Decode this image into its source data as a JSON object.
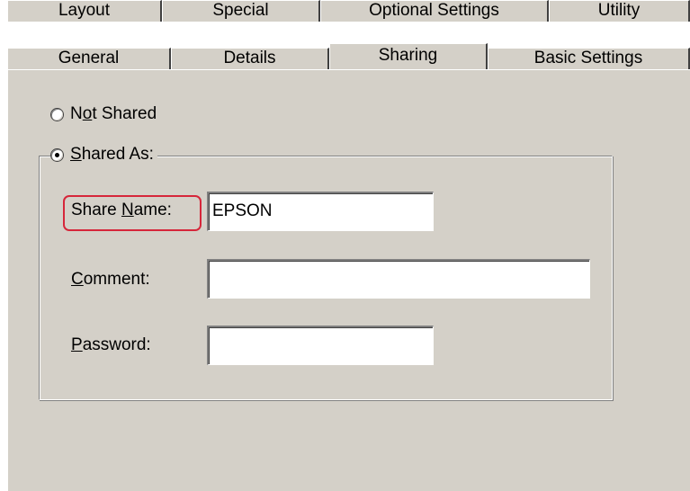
{
  "tabs_row1": [
    {
      "label": "Layout"
    },
    {
      "label": "Special"
    },
    {
      "label": "Optional Settings"
    },
    {
      "label": "Utility"
    }
  ],
  "tabs_row2": [
    {
      "label": "General"
    },
    {
      "label": "Details"
    },
    {
      "label": "Sharing",
      "active": true
    },
    {
      "label": "Basic Settings"
    }
  ],
  "sharing": {
    "not_shared_label": {
      "pre": "N",
      "mn": "o",
      "post": "t Shared"
    },
    "shared_as_label": {
      "pre": "",
      "mn": "S",
      "post": "hared As:"
    },
    "selected": "shared_as",
    "share_name_label": {
      "pre": "Share ",
      "mn": "N",
      "post": "ame:"
    },
    "share_name_value": "EPSON",
    "comment_label": {
      "pre": "",
      "mn": "C",
      "post": "omment:"
    },
    "comment_value": "",
    "password_label": {
      "pre": "",
      "mn": "P",
      "post": "assword:"
    },
    "password_value": ""
  },
  "colors": {
    "face": "#d4d0c8",
    "highlight_outline": "#d6263a"
  }
}
